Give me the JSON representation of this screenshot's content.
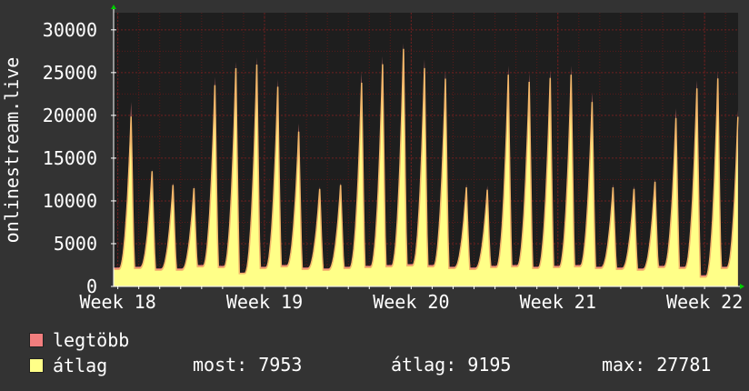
{
  "chart_data": {
    "type": "line",
    "ylabel": "onlinestream.live",
    "ylim": [
      0,
      32000
    ],
    "y_ticks": [
      0,
      5000,
      10000,
      15000,
      20000,
      25000,
      30000
    ],
    "x_tick_labels": [
      "Week 18",
      "Week 19",
      "Week 20",
      "Week 21",
      "Week 22"
    ],
    "x_range_days": [
      -0.2,
      29.6
    ],
    "grid": true,
    "colors": {
      "background": "#333333",
      "plot_bg": "#1e1e1e",
      "grid_minor": "#5a1a1a",
      "grid_major": "#6e2020",
      "axis": "#ffffff",
      "max_fill": "#f27e7e",
      "avg_fill": "#ffff88",
      "avg_line": "#f2b66a"
    },
    "series": [
      {
        "name": "legtöbb",
        "daily_peaks": [
          22800,
          14400,
          12800,
          12400,
          25900,
          27800,
          28400,
          25600,
          20100,
          12300,
          12800,
          26500,
          28500,
          30100,
          28100,
          26800,
          12600,
          12400,
          27300,
          26400,
          26800,
          27300,
          24000,
          12600,
          12400,
          13300,
          22000,
          25500,
          26700,
          25300,
          12500
        ],
        "daily_troughs": [
          2200,
          2300,
          2100,
          2100,
          2500,
          2400,
          1600,
          2300,
          2500,
          2200,
          2100,
          2300,
          2400,
          2500,
          2600,
          2500,
          2300,
          2200,
          2400,
          2500,
          2300,
          2400,
          2500,
          2300,
          2200,
          2100,
          2400,
          2300,
          1300,
          2300,
          7800
        ]
      },
      {
        "name": "átlag",
        "daily_peaks": [
          21000,
          14200,
          12500,
          12100,
          24900,
          27000,
          27500,
          24700,
          19100,
          12000,
          12500,
          25200,
          27500,
          29400,
          27000,
          25700,
          12200,
          11900,
          26200,
          25300,
          25800,
          26200,
          22800,
          12200,
          12000,
          12900,
          20800,
          24500,
          25800,
          24300,
          12200
        ],
        "daily_troughs": [
          2000,
          2100,
          1900,
          1900,
          2300,
          2200,
          1500,
          2100,
          2300,
          2000,
          1900,
          2100,
          2200,
          2300,
          2400,
          2300,
          2100,
          2000,
          2200,
          2300,
          2100,
          2200,
          2300,
          2100,
          2000,
          1900,
          2200,
          2100,
          1100,
          2100,
          7700
        ]
      }
    ]
  },
  "legend": {
    "max_label": "legtöbb",
    "avg_label": "átlag"
  },
  "stats": {
    "now": "most: 7953",
    "avg": "átlag: 9195",
    "max": "max: 27781"
  }
}
